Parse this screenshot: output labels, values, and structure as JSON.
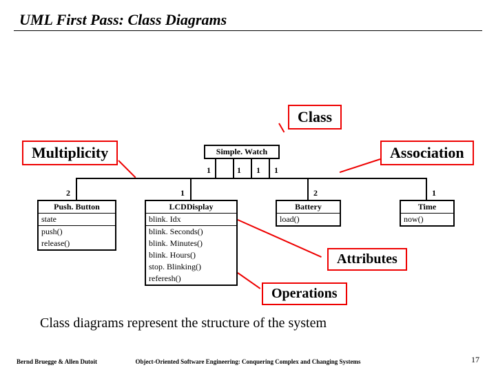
{
  "title": "UML First Pass: Class Diagrams",
  "annotations": {
    "class": "Class",
    "multiplicity": "Multiplicity",
    "association": "Association",
    "attributes": "Attributes",
    "operations": "Operations"
  },
  "classes": {
    "simplewatch": {
      "name": "Simple. Watch"
    },
    "pushbutton": {
      "name": "Push. Button",
      "attrs": [
        "state"
      ],
      "ops": [
        "push()",
        "release()"
      ]
    },
    "lcddisplay": {
      "name": "LCDDisplay",
      "attrs": [
        "blink. Idx"
      ],
      "ops": [
        "blink. Seconds()",
        "blink. Minutes()",
        "blink. Hours()",
        "stop. Blinking()",
        "referesh()"
      ]
    },
    "battery": {
      "name": "Battery",
      "ops": [
        "load()"
      ]
    },
    "time": {
      "name": "Time",
      "ops": [
        "now()"
      ]
    }
  },
  "multiplicities": {
    "sw_pb_top": "1",
    "sw_lcd_top": "1",
    "sw_bat_top": "1",
    "sw_time_top": "1",
    "pb_bottom": "2",
    "lcd_bottom": "1",
    "bat_bottom": "2",
    "time_bottom": "1"
  },
  "caption": "Class diagrams represent the structure of the system",
  "footer": {
    "left": "Bernd Bruegge & Allen Dutoit",
    "center": "Object-Oriented Software Engineering: Conquering Complex and Changing Systems",
    "right": "17"
  }
}
